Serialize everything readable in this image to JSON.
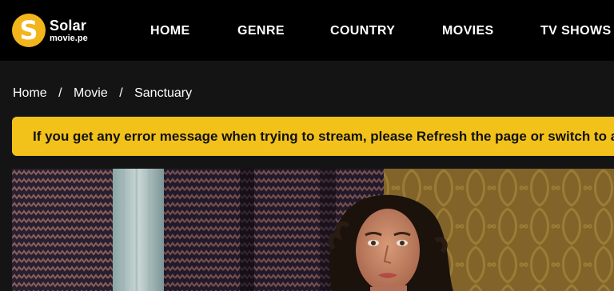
{
  "brand": {
    "name": "Solar",
    "domain": "movie.pe",
    "logo_letter": "S",
    "accent_color": "#f2b51b"
  },
  "nav": {
    "home": "HOME",
    "genre": "GENRE",
    "country": "COUNTRY",
    "movies": "MOVIES",
    "tv_shows": "TV SHOWS"
  },
  "breadcrumb": {
    "home": "Home",
    "movie": "Movie",
    "current": "Sanctuary",
    "separator": "/"
  },
  "notice": {
    "text": "If you get any error message when trying to stream, please Refresh the page or switch to another streaming server.",
    "background": "#f2c21b"
  }
}
